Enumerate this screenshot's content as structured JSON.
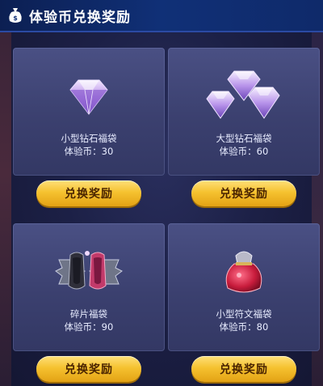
{
  "header": {
    "title": "体验币兑换奖励",
    "icon": "coin-bag-icon"
  },
  "rewards": [
    {
      "name": "小型钻石福袋",
      "price": "体验币：30",
      "icon": "small-diamond-icon",
      "button": "兑换奖励"
    },
    {
      "name": "大型钻石福袋",
      "price": "体验币：60",
      "icon": "large-diamond-cluster-icon",
      "button": "兑换奖励"
    },
    {
      "name": "碎片福袋",
      "price": "体验币：90",
      "icon": "fragment-bag-icon",
      "button": "兑换奖励"
    },
    {
      "name": "小型符文福袋",
      "price": "体验币：80",
      "icon": "rune-bag-icon",
      "button": "兑换奖励"
    }
  ],
  "colors": {
    "header_bg": "#103077",
    "card_bg": "#3b406f",
    "button_gold": "#f5c230",
    "button_text": "#4a2400"
  }
}
